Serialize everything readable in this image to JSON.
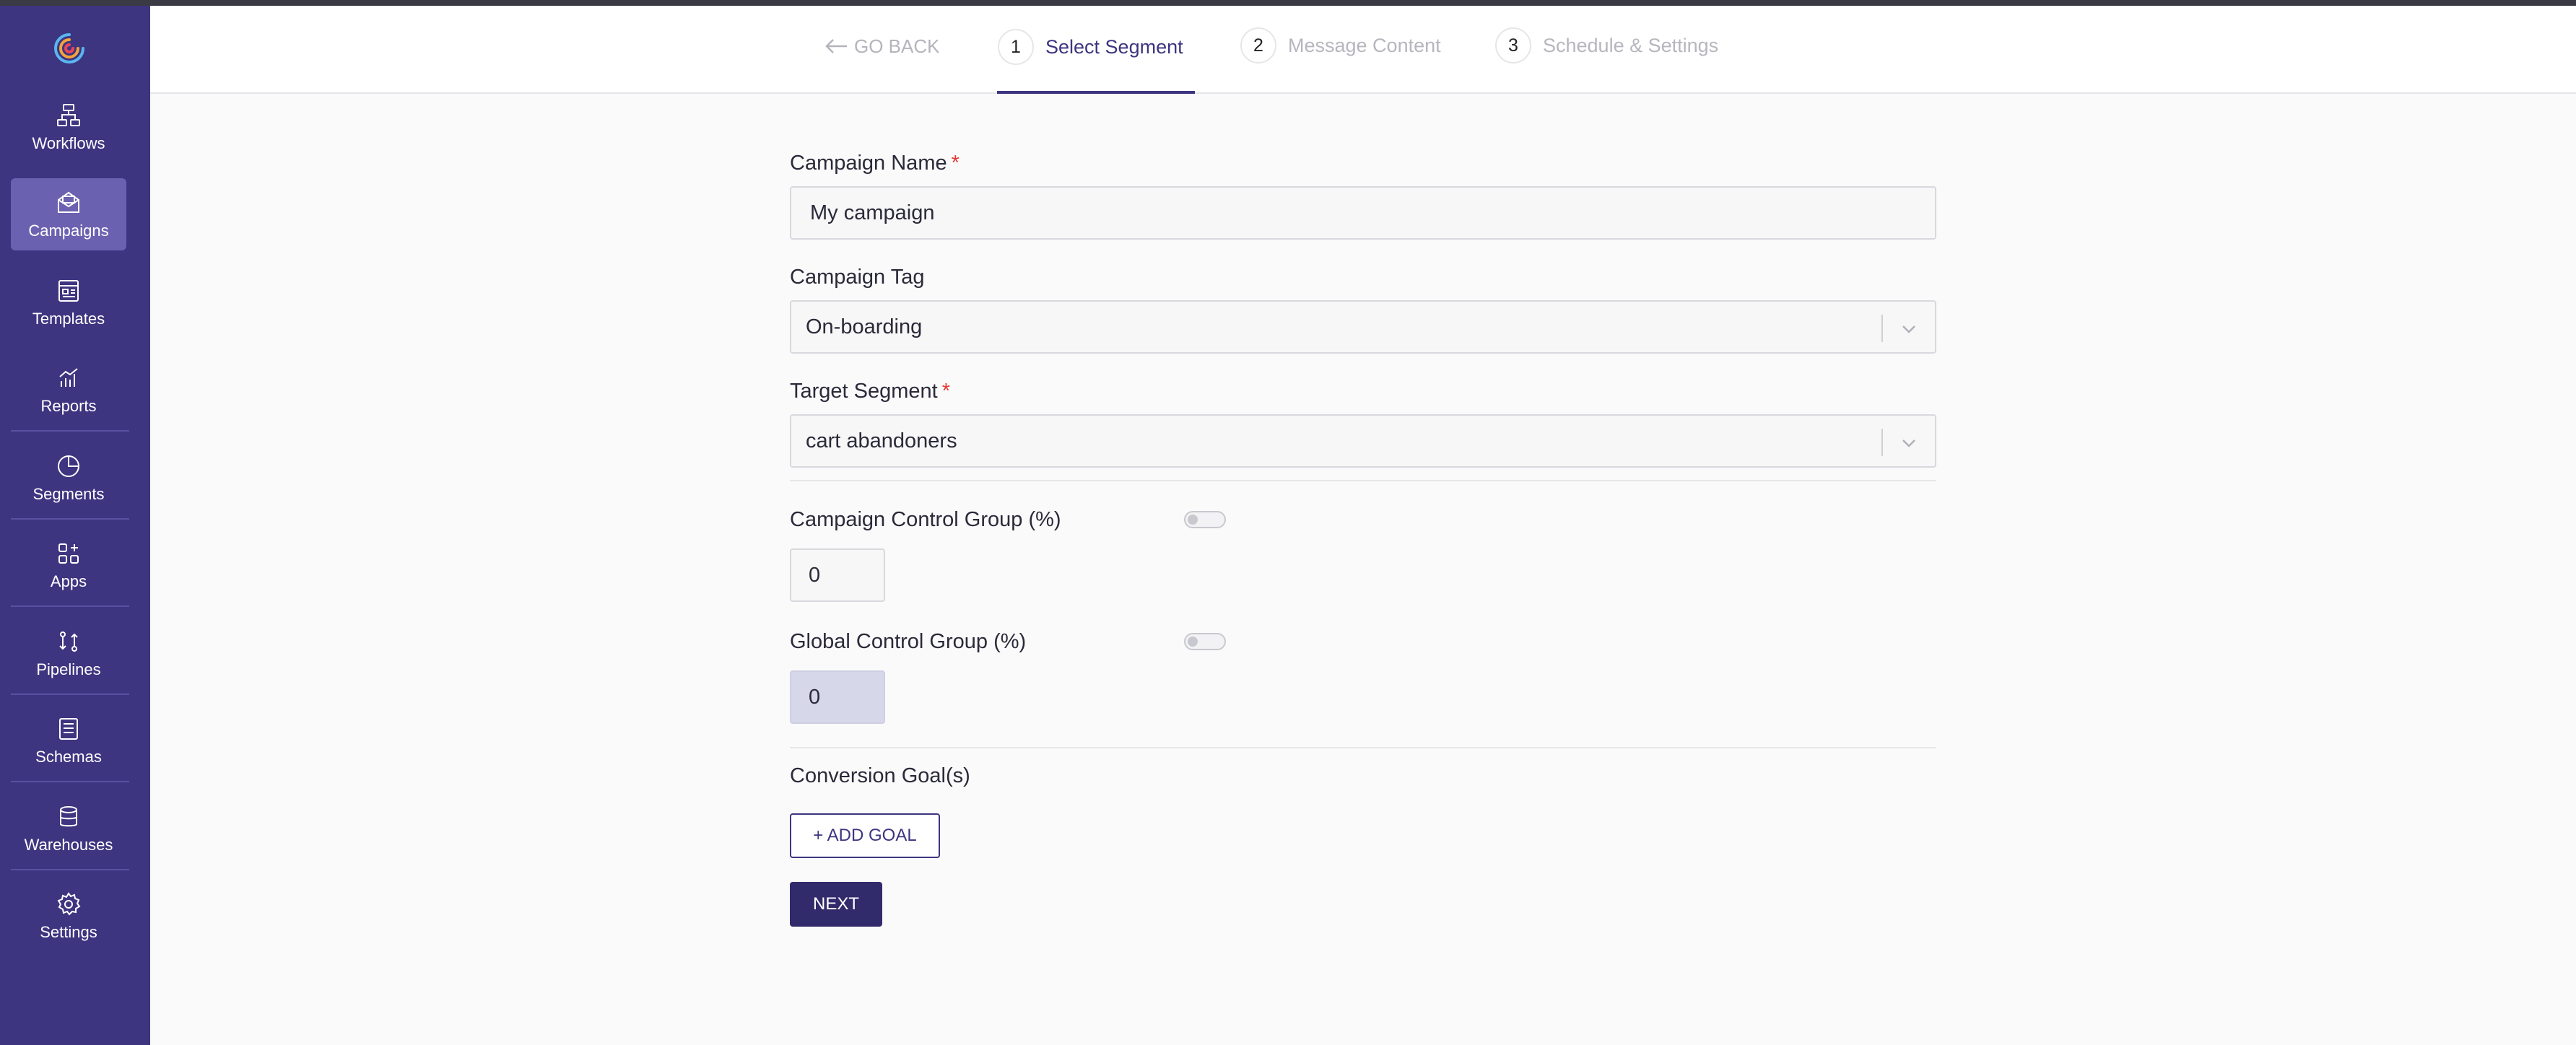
{
  "colors": {
    "sidebar_bg": "#3d3580",
    "sidebar_active": "#6a62b0",
    "primary": "#312a6b",
    "required": "#e53935",
    "muted_text": "#b6b6be"
  },
  "sidebar": {
    "logo": "app-logo-icon",
    "items": [
      {
        "label": "Workflows",
        "icon": "workflows-icon"
      },
      {
        "label": "Campaigns",
        "icon": "campaigns-icon",
        "active": true
      },
      {
        "label": "Templates",
        "icon": "templates-icon"
      },
      {
        "label": "Reports",
        "icon": "reports-icon"
      },
      {
        "label": "Segments",
        "icon": "segments-icon"
      },
      {
        "label": "Apps",
        "icon": "apps-icon"
      },
      {
        "label": "Pipelines",
        "icon": "pipelines-icon"
      },
      {
        "label": "Schemas",
        "icon": "schemas-icon"
      },
      {
        "label": "Warehouses",
        "icon": "warehouses-icon"
      },
      {
        "label": "Settings",
        "icon": "settings-icon"
      }
    ]
  },
  "header": {
    "go_back": "GO BACK",
    "steps": [
      {
        "num": "1",
        "label": "Select Segment",
        "active": true
      },
      {
        "num": "2",
        "label": "Message Content"
      },
      {
        "num": "3",
        "label": "Schedule & Settings"
      }
    ]
  },
  "form": {
    "campaign_name": {
      "label": "Campaign Name",
      "required_mark": "*",
      "value": "My campaign"
    },
    "campaign_tag": {
      "label": "Campaign Tag",
      "value": "On-boarding"
    },
    "target_segment": {
      "label": "Target Segment",
      "required_mark": "*",
      "value": "cart abandoners"
    },
    "campaign_control_group": {
      "label": "Campaign Control Group (%)",
      "value": "0",
      "toggle_on": false
    },
    "global_control_group": {
      "label": "Global Control Group (%)",
      "value": "0",
      "toggle_on": false
    },
    "conversion_goals": {
      "label": "Conversion Goal(s)",
      "add_button": "+ ADD GOAL"
    },
    "next_button": "NEXT"
  }
}
